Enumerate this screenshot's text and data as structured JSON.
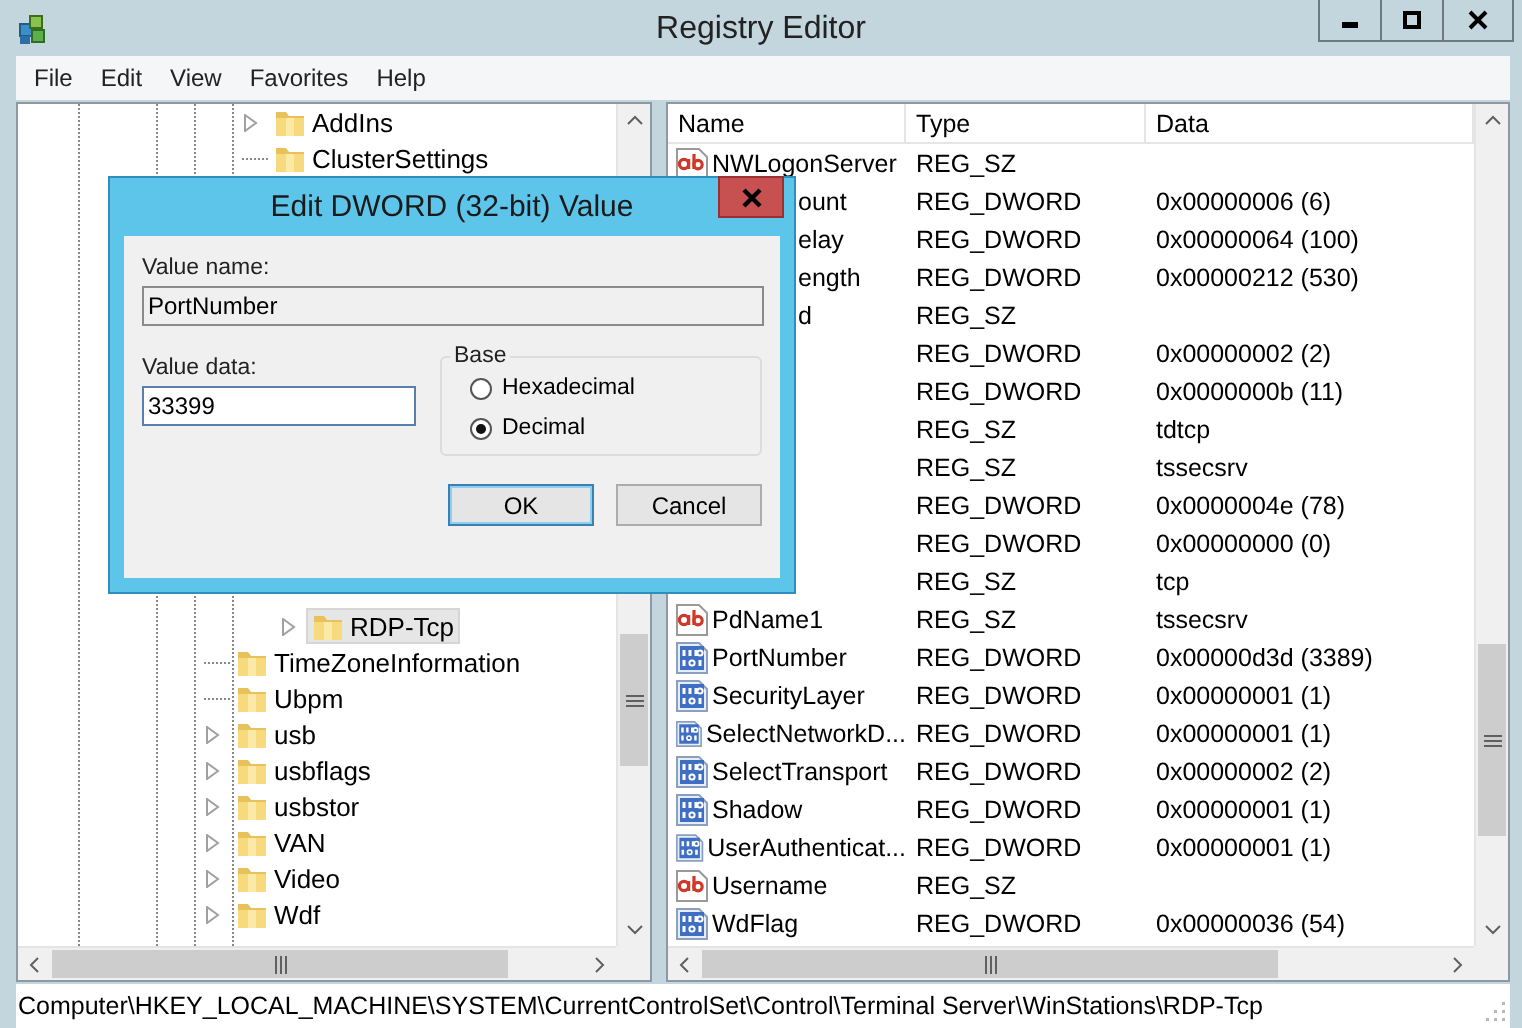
{
  "window": {
    "title": "Registry Editor"
  },
  "menu": [
    "File",
    "Edit",
    "View",
    "Favorites",
    "Help"
  ],
  "tree": {
    "items": [
      {
        "children": [
          {
            "label": "AddIns",
            "expandable": true,
            "selected": false
          },
          {
            "label": "ClusterSettings",
            "expandable": false,
            "selected": false
          },
          {
            "children": [
              {
                "label": "RDP-Tcp",
                "expandable": true,
                "selected": true
              }
            ]
          }
        ]
      },
      {
        "label": "TimeZoneInformation",
        "expandable": false,
        "selected": false
      },
      {
        "label": "Ubpm",
        "expandable": false,
        "selected": false
      },
      {
        "label": "usb",
        "expandable": true,
        "selected": false
      },
      {
        "label": "usbflags",
        "expandable": true,
        "selected": false
      },
      {
        "label": "usbstor",
        "expandable": true,
        "selected": false
      },
      {
        "label": "VAN",
        "expandable": true,
        "selected": false
      },
      {
        "label": "Video",
        "expandable": true,
        "selected": false
      },
      {
        "label": "Wdf",
        "expandable": true,
        "selected": false
      }
    ]
  },
  "values": {
    "columns": [
      "Name",
      "Type",
      "Data"
    ],
    "rows": [
      {
        "kind": "string",
        "name": "NWLogonServer",
        "type": "REG_SZ"
      },
      {
        "kind": "covered",
        "name": "ount",
        "type": "REG_DWORD",
        "data": "0x00000006 (6)"
      },
      {
        "kind": "covered",
        "name": "elay",
        "type": "REG_DWORD",
        "data": "0x00000064 (100)"
      },
      {
        "kind": "covered",
        "name": "ength",
        "type": "REG_DWORD",
        "data": "0x00000212 (530)"
      },
      {
        "kind": "covered",
        "name": "d",
        "type": "REG_SZ"
      },
      {
        "kind": "covered",
        "type": "REG_DWORD",
        "data": "0x00000002 (2)"
      },
      {
        "kind": "covered",
        "type": "REG_DWORD",
        "data": "0x0000000b (11)"
      },
      {
        "kind": "covered",
        "type": "REG_SZ",
        "data": "tdtcp"
      },
      {
        "kind": "covered",
        "type": "REG_SZ",
        "data": "tssecsrv"
      },
      {
        "kind": "covered",
        "type": "REG_DWORD",
        "data": "0x0000004e (78)"
      },
      {
        "kind": "covered",
        "type": "REG_DWORD",
        "data": "0x00000000 (0)"
      },
      {
        "kind": "covered",
        "type": "REG_SZ",
        "data": "tcp"
      },
      {
        "kind": "string",
        "name": "PdName1",
        "type": "REG_SZ",
        "data": "tssecsrv"
      },
      {
        "kind": "binary",
        "name": "PortNumber",
        "type": "REG_DWORD",
        "data": "0x00000d3d (3389)"
      },
      {
        "kind": "binary",
        "name": "SecurityLayer",
        "type": "REG_DWORD",
        "data": "0x00000001 (1)"
      },
      {
        "kind": "binary",
        "name": "SelectNetworkD...",
        "type": "REG_DWORD",
        "data": "0x00000001 (1)"
      },
      {
        "kind": "binary",
        "name": "SelectTransport",
        "type": "REG_DWORD",
        "data": "0x00000002 (2)"
      },
      {
        "kind": "binary",
        "name": "Shadow",
        "type": "REG_DWORD",
        "data": "0x00000001 (1)"
      },
      {
        "kind": "binary",
        "name": "UserAuthenticat...",
        "type": "REG_DWORD",
        "data": "0x00000001 (1)"
      },
      {
        "kind": "string",
        "name": "Username",
        "type": "REG_SZ"
      },
      {
        "kind": "binary",
        "name": "WdFlag",
        "type": "REG_DWORD",
        "data": "0x00000036 (54)"
      }
    ]
  },
  "status_bar": "Computer\\HKEY_LOCAL_MACHINE\\SYSTEM\\CurrentControlSet\\Control\\Terminal Server\\WinStations\\RDP-Tcp",
  "dialog": {
    "title": "Edit DWORD (32-bit) Value",
    "value_name_label": "Value name:",
    "value_name": "PortNumber",
    "value_data_label": "Value data:",
    "value_data": "33399",
    "base_label": "Base",
    "base_options": [
      {
        "label": "Hexadecimal",
        "selected": false
      },
      {
        "label": "Decimal",
        "selected": true
      }
    ],
    "buttons": [
      {
        "label": "OK",
        "default": true
      },
      {
        "label": "Cancel",
        "default": false
      }
    ]
  }
}
